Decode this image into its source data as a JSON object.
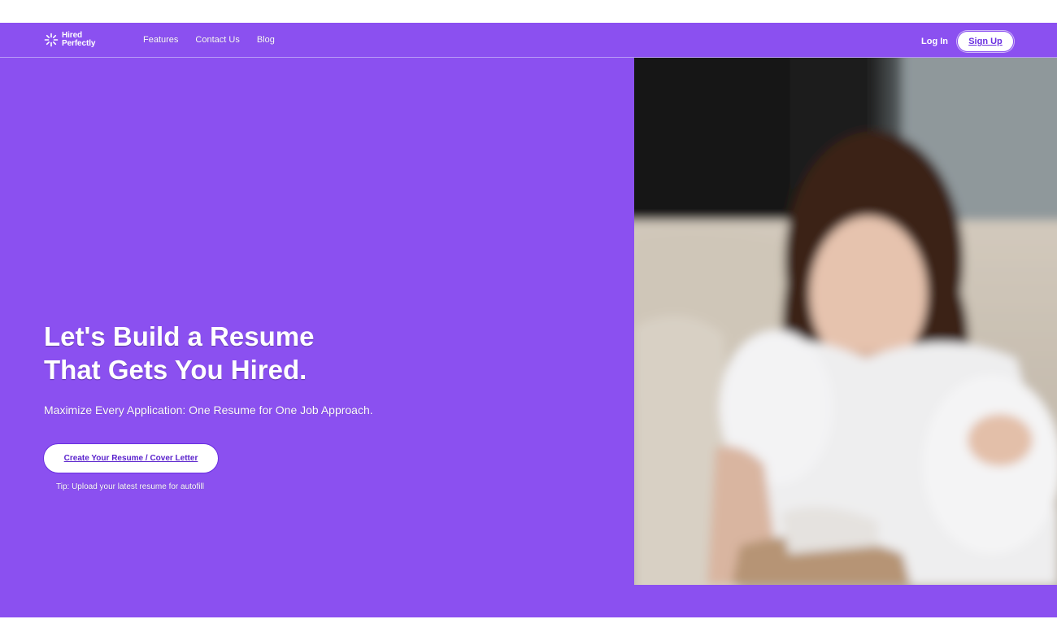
{
  "brand": {
    "name_line1": "Hired",
    "name_line2": "Perfectly",
    "icon": "sparkle-logo-icon"
  },
  "nav": {
    "links": [
      "Features",
      "Contact Us",
      "Blog"
    ],
    "login_label": "Log In",
    "signup_label": "Sign Up"
  },
  "hero": {
    "title_line1": "Let's Build a Resume",
    "title_line2": "That Gets You Hired.",
    "subtitle": "Maximize Every Application: One Resume for One Job Approach.",
    "cta_label": "Create Your Resume / Cover Letter",
    "tip": "Tip: Upload your latest resume for autofill",
    "image": "woman-on-couch-photo"
  },
  "colors": {
    "brand_purple": "#8b50f0",
    "button_text": "#5a22cc",
    "white": "#ffffff"
  }
}
